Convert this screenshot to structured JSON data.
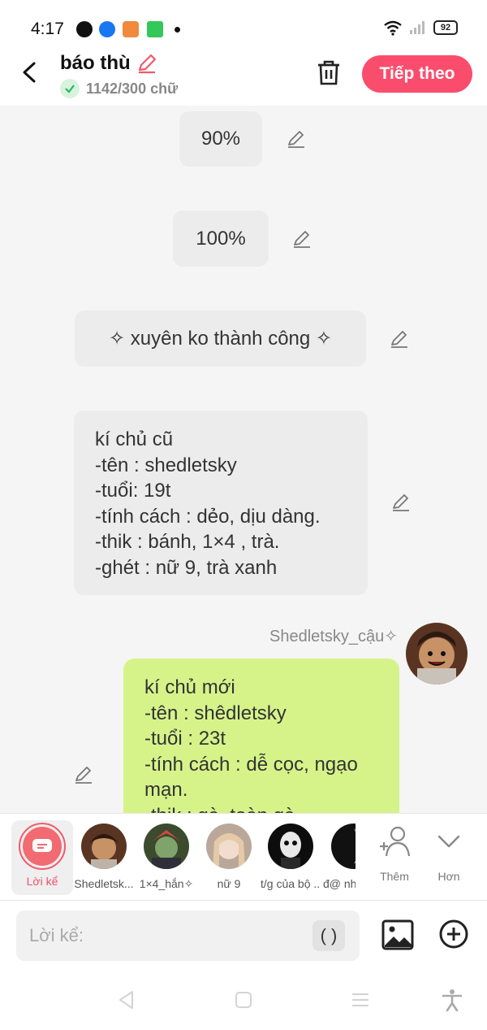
{
  "status_bar": {
    "time": "4:17",
    "battery": "92",
    "apps": [
      "messenger-icon",
      "facebook-icon",
      "game-icon",
      "calculator-icon"
    ]
  },
  "header": {
    "title": "báo thù",
    "word_count": "1142/300 chữ",
    "next_label": "Tiếp theo",
    "accent": "#fa4d6d"
  },
  "messages": {
    "m1": "90%",
    "m2": "100%",
    "m3": "✧ xuyên ko thành công ✧",
    "m4": "kí chủ cũ\n-tên : shedletsky\n-tuổi: 19t\n-tính cách : dẻo, dịu dàng.\n-thik : bánh, 1×4 , trà.\n-ghét : nữ 9, trà xanh",
    "sender": "Shedletsky_cậu✧",
    "m5": "kí chủ mới\n-tên : shêdletsky\n-tuổi : 23t\n-tính cách : dễ cọc, ngạo mạn.\n-thik : gà, toàn gà"
  },
  "characters": [
    {
      "name": "Lời kể"
    },
    {
      "name": "Shedletsk..."
    },
    {
      "name": "1×4_hắn✧"
    },
    {
      "name": "nữ 9"
    },
    {
      "name": "t/g của bộ ..."
    },
    {
      "name": "đ@ nh"
    }
  ],
  "tools": {
    "more_label": "Thêm",
    "collapse_label": "Hơn"
  },
  "input": {
    "placeholder": "Lời kể:",
    "paren": "( )"
  }
}
